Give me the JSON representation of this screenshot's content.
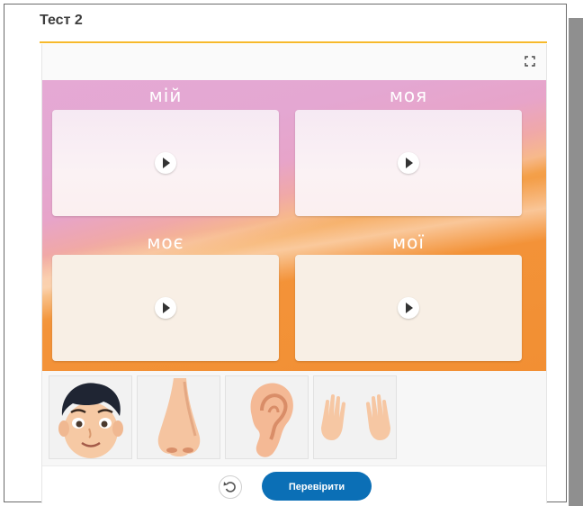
{
  "page": {
    "title": "Тест 2"
  },
  "toolbar": {
    "fullscreen_icon": "fullscreen-icon"
  },
  "slots": [
    {
      "label": "мій",
      "icon": "play-icon"
    },
    {
      "label": "моя",
      "icon": "play-icon"
    },
    {
      "label": "моє",
      "icon": "play-icon"
    },
    {
      "label": "мої",
      "icon": "play-icon"
    }
  ],
  "cards": [
    {
      "name": "face-card",
      "icon": "boy-face-image"
    },
    {
      "name": "nose-card",
      "icon": "nose-image"
    },
    {
      "name": "ear-card",
      "icon": "ear-image"
    },
    {
      "name": "hands-card",
      "icon": "hands-image"
    }
  ],
  "footer": {
    "reset_icon": "reset-icon",
    "check_label": "Перевірити"
  },
  "colors": {
    "accent_line": "#f6b92b",
    "button": "#0b6fb6",
    "board_top": "#e5a9d4",
    "board_bottom": "#f28f33"
  }
}
